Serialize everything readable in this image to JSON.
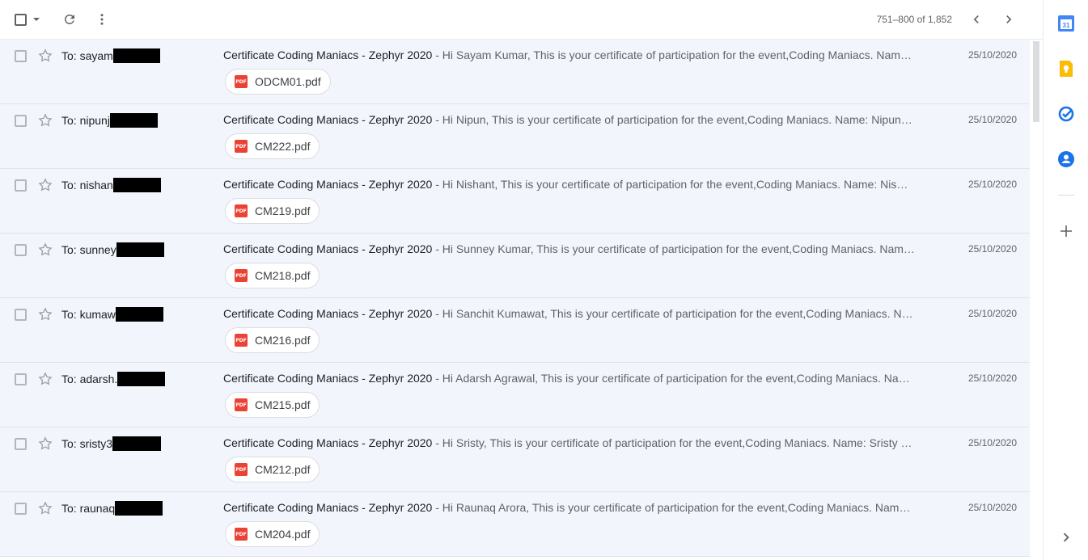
{
  "toolbar": {
    "pager": "751–800 of 1,852"
  },
  "icons": {
    "select_all": "checkbox-icon",
    "select_menu": "caret-down-icon",
    "refresh": "refresh-icon",
    "more": "more-vert-icon",
    "prev": "chevron-left-icon",
    "next": "chevron-right-icon"
  },
  "emails": [
    {
      "to_prefix": "To: sayam",
      "subject": "Certificate Coding Maniacs - Zephyr 2020",
      "snippet": " - Hi Sayam Kumar, This is your certificate of participation for the event,Coding Maniacs. Nam…",
      "date": "25/10/2020",
      "attachment": "ODCM01.pdf"
    },
    {
      "to_prefix": "To: nipunj",
      "subject": "Certificate Coding Maniacs - Zephyr 2020",
      "snippet": " - Hi Nipun, This is your certificate of participation for the event,Coding Maniacs. Name: Nipun…",
      "date": "25/10/2020",
      "attachment": "CM222.pdf"
    },
    {
      "to_prefix": "To: nishan",
      "subject": "Certificate Coding Maniacs - Zephyr 2020",
      "snippet": " - Hi Nishant, This is your certificate of participation for the event,Coding Maniacs. Name: Nis…",
      "date": "25/10/2020",
      "attachment": "CM219.pdf"
    },
    {
      "to_prefix": "To: sunney",
      "subject": "Certificate Coding Maniacs - Zephyr 2020",
      "snippet": " - Hi Sunney Kumar, This is your certificate of participation for the event,Coding Maniacs. Nam…",
      "date": "25/10/2020",
      "attachment": "CM218.pdf"
    },
    {
      "to_prefix": "To: kumaw",
      "subject": "Certificate Coding Maniacs - Zephyr 2020",
      "snippet": " - Hi Sanchit Kumawat, This is your certificate of participation for the event,Coding Maniacs. N…",
      "date": "25/10/2020",
      "attachment": "CM216.pdf"
    },
    {
      "to_prefix": "To: adarsh.",
      "subject": "Certificate Coding Maniacs - Zephyr 2020",
      "snippet": " - Hi Adarsh Agrawal, This is your certificate of participation for the event,Coding Maniacs. Na…",
      "date": "25/10/2020",
      "attachment": "CM215.pdf"
    },
    {
      "to_prefix": "To: sristy3",
      "subject": "Certificate Coding Maniacs - Zephyr 2020",
      "snippet": " - Hi Sristy, This is your certificate of participation for the event,Coding Maniacs. Name: Sristy …",
      "date": "25/10/2020",
      "attachment": "CM212.pdf"
    },
    {
      "to_prefix": "To: raunaq",
      "subject": "Certificate Coding Maniacs - Zephyr 2020",
      "snippet": " - Hi Raunaq Arora, This is your certificate of participation for the event,Coding Maniacs. Nam…",
      "date": "25/10/2020",
      "attachment": "CM204.pdf"
    }
  ],
  "attachment_badge": "PDF",
  "side_panel": {
    "apps": [
      "calendar-icon",
      "keep-icon",
      "tasks-icon",
      "contacts-icon",
      "add-icon",
      "expand-icon"
    ],
    "calendar_day": "31"
  },
  "colors": {
    "row_bg": "#f2f6fc",
    "pdf_red": "#ea4335",
    "calendar_blue": "#4285f4",
    "keep_yellow": "#fbbc04",
    "tasks_blue": "#1a73e8"
  }
}
